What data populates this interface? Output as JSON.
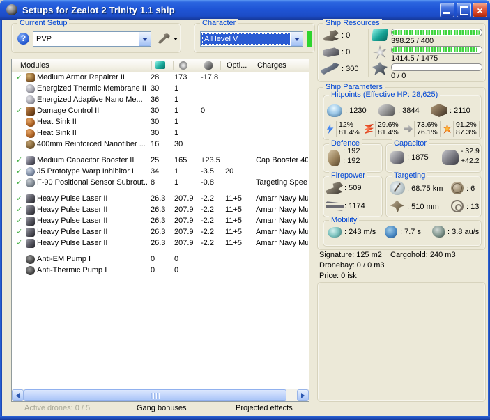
{
  "window": {
    "title": "Setups for Zealot 2 Trinity 1.1 ship",
    "close_glyph": "×"
  },
  "colors": {
    "titlebar_blue": "#1f55d6",
    "groupbox_label_blue": "#0046d5",
    "selection_blue": "#2a5cd3",
    "progress_green": "#3fd43f",
    "active_check_green": "#44b044",
    "character_bar_green": "#2ed32e"
  },
  "current_setup": {
    "label": "Current Setup",
    "value": "PVP",
    "help_glyph": "?"
  },
  "character": {
    "label": "Character",
    "value": "All level V"
  },
  "modules_table": {
    "headers": {
      "modules": "Modules",
      "opti": "Opti...",
      "charges": "Charges"
    },
    "rows": [
      {
        "slot": "low",
        "active": true,
        "icon": "repairer",
        "name": "Medium Armor Repairer II",
        "cpu": "28",
        "pg": "173",
        "cap": "-17.8",
        "opti": "",
        "charges": ""
      },
      {
        "slot": "low",
        "active": false,
        "icon": "membrane",
        "name": "Energized Thermic Membrane II",
        "cpu": "30",
        "pg": "1",
        "cap": "",
        "opti": "",
        "charges": ""
      },
      {
        "slot": "low",
        "active": false,
        "icon": "membrane",
        "name": "Energized Adaptive Nano Me...",
        "cpu": "36",
        "pg": "1",
        "cap": "",
        "opti": "",
        "charges": ""
      },
      {
        "slot": "low",
        "active": true,
        "icon": "dcu",
        "name": "Damage Control II",
        "cpu": "30",
        "pg": "1",
        "cap": "0",
        "opti": "",
        "charges": ""
      },
      {
        "slot": "low",
        "active": false,
        "icon": "heatsink",
        "name": "Heat Sink II",
        "cpu": "30",
        "pg": "1",
        "cap": "",
        "opti": "",
        "charges": ""
      },
      {
        "slot": "low",
        "active": false,
        "icon": "heatsink",
        "name": "Heat Sink II",
        "cpu": "30",
        "pg": "1",
        "cap": "",
        "opti": "",
        "charges": ""
      },
      {
        "slot": "low",
        "active": false,
        "icon": "plate",
        "name": "400mm Reinforced Nanofiber ...",
        "cpu": "16",
        "pg": "30",
        "cap": "",
        "opti": "",
        "charges": ""
      },
      {
        "slot": "mid",
        "active": true,
        "icon": "capbooster",
        "name": "Medium Capacitor Booster II",
        "cpu": "25",
        "pg": "165",
        "cap": "+23.5",
        "opti": "",
        "charges": "Cap Booster 40"
      },
      {
        "slot": "mid",
        "active": true,
        "icon": "warpdis",
        "name": "J5 Prototype Warp Inhibitor I",
        "cpu": "34",
        "pg": "1",
        "cap": "-3.5",
        "opti": "20",
        "charges": ""
      },
      {
        "slot": "mid",
        "active": true,
        "icon": "sensor",
        "name": "F-90 Positional Sensor Subrout...",
        "cpu": "8",
        "pg": "1",
        "cap": "-0.8",
        "opti": "",
        "charges": "Targeting Spee"
      },
      {
        "slot": "high",
        "active": true,
        "icon": "laser",
        "name": "Heavy Pulse Laser II",
        "cpu": "26.3",
        "pg": "207.9",
        "cap": "-2.2",
        "opti": "11+5",
        "charges": "Amarr Navy Mu"
      },
      {
        "slot": "high",
        "active": true,
        "icon": "laser",
        "name": "Heavy Pulse Laser II",
        "cpu": "26.3",
        "pg": "207.9",
        "cap": "-2.2",
        "opti": "11+5",
        "charges": "Amarr Navy Mu"
      },
      {
        "slot": "high",
        "active": true,
        "icon": "laser",
        "name": "Heavy Pulse Laser II",
        "cpu": "26.3",
        "pg": "207.9",
        "cap": "-2.2",
        "opti": "11+5",
        "charges": "Amarr Navy Mu"
      },
      {
        "slot": "high",
        "active": true,
        "icon": "laser",
        "name": "Heavy Pulse Laser II",
        "cpu": "26.3",
        "pg": "207.9",
        "cap": "-2.2",
        "opti": "11+5",
        "charges": "Amarr Navy Mu"
      },
      {
        "slot": "high",
        "active": true,
        "icon": "laser",
        "name": "Heavy Pulse Laser II",
        "cpu": "26.3",
        "pg": "207.9",
        "cap": "-2.2",
        "opti": "11+5",
        "charges": "Amarr Navy Mu"
      },
      {
        "slot": "rig",
        "active": false,
        "icon": "rig",
        "name": "Anti-EM Pump I",
        "cpu": "0",
        "pg": "0",
        "cap": "",
        "opti": "",
        "charges": ""
      },
      {
        "slot": "rig",
        "active": false,
        "icon": "rig",
        "name": "Anti-Thermic Pump I",
        "cpu": "0",
        "pg": "0",
        "cap": "",
        "opti": "",
        "charges": ""
      }
    ]
  },
  "ship_resources": {
    "label": "Ship Resources",
    "turrets": ": 0",
    "launchers": ": 0",
    "calibration": ": 300",
    "cpu": {
      "text": "398.25 / 400",
      "fill_pct": 99
    },
    "powergrid": {
      "text": "1414.5 / 1475",
      "fill_pct": 96
    },
    "dronebandwidth": {
      "text": "0 / 0",
      "fill_pct": 0
    }
  },
  "ship_parameters": {
    "label": "Ship Parameters",
    "hitpoints": {
      "label": "Hitpoints (Effective HP: 28,625)",
      "shield": ": 1230",
      "armor": ": 3844",
      "hull": ": 2110",
      "resists": [
        {
          "type": "em",
          "shield": "12%",
          "armor": "81.4%"
        },
        {
          "type": "thermal",
          "shield": "29.6%",
          "armor": "81.4%"
        },
        {
          "type": "kinetic",
          "shield": "73.6%",
          "armor": "76.1%"
        },
        {
          "type": "explosive",
          "shield": "91.2%",
          "armor": "87.3%"
        }
      ]
    },
    "defence": {
      "label": "Defence",
      "value_top": ": 192",
      "value_bottom": ": 192"
    },
    "capacitor": {
      "label": "Capacitor",
      "amount": ": 1875",
      "drain": "- 32.9",
      "recharge": "+42.2"
    },
    "firepower": {
      "label": "Firepower",
      "volley": ": 509",
      "dps": ": 1174"
    },
    "targeting": {
      "label": "Targeting",
      "range": ": 68.75 km",
      "max_targets": ": 6",
      "scan_resolution": ": 510 mm",
      "sensor_strength": ": 13"
    },
    "mobility": {
      "label": "Mobility",
      "speed": ": 243 m/s",
      "align_time": ": 7.7 s",
      "warp_speed": ": 3.8 au/s"
    }
  },
  "stats": {
    "signature": "Signature: 125 m2",
    "cargohold": "Cargohold: 240 m3",
    "dronebay": "Dronebay: 0 / 0 m3",
    "price": "Price: 0 isk"
  },
  "footer": {
    "active_drones": "Active drones: 0 / 5",
    "gang_bonuses": "Gang bonuses",
    "projected_effects": "Projected effects"
  }
}
